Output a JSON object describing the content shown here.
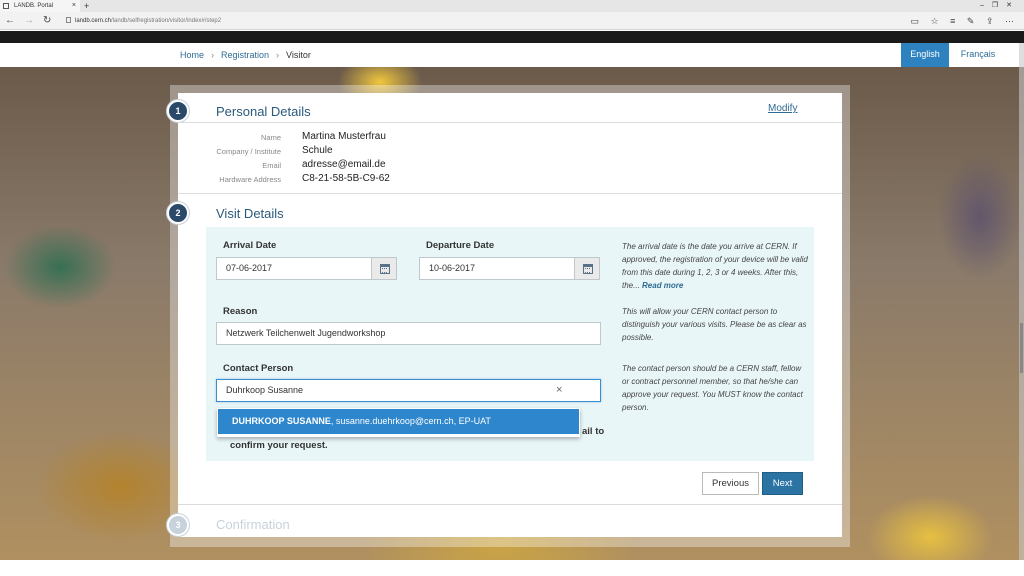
{
  "browser": {
    "tab_title": "LANDB. Portal",
    "url_host": "landb.cern.ch",
    "url_path": "/landb/selfregistration/visitor/index#/step2"
  },
  "breadcrumb": {
    "home": "Home",
    "registration": "Registration",
    "current": "Visitor"
  },
  "languages": {
    "english": "English",
    "french": "Français"
  },
  "steps": {
    "s1": {
      "number": "1",
      "title": "Personal Details",
      "modify": "Modify"
    },
    "s2": {
      "number": "2",
      "title": "Visit Details"
    },
    "s3": {
      "number": "3",
      "title": "Confirmation"
    }
  },
  "personal": {
    "name_label": "Name",
    "name": "Martina Musterfrau",
    "company_label": "Company / Institute",
    "company": "Schule",
    "email_label": "Email",
    "email": "adresse@email.de",
    "hw_label": "Hardware Address",
    "hw": "C8-21-58-5B-C9-62"
  },
  "visit": {
    "arrival_label": "Arrival Date",
    "arrival": "07-06-2017",
    "departure_label": "Departure Date",
    "departure": "10-06-2017",
    "reason_label": "Reason",
    "reason": "Netzwerk Teilchenwelt Jugendworkshop",
    "contact_label": "Contact Person",
    "contact": "Duhrkoop Susanne",
    "help_dates": "The arrival date is the date you arrive at CERN. If approved, the registration of your device will be valid from this date during 1, 2, 3 or 4 weeks. After this, the... ",
    "read_more": "Read more",
    "help_reason": "This will allow your CERN contact person to distinguish your various visits. Please be as clear as possible.",
    "help_contact": "The contact person should be a CERN staff, fellow or contract personnel member, so that he/she can approve your request. You MUST know the contact person.",
    "suggestion_name": "DUHRKOOP SUSANNE",
    "suggestion_rest": ", susanne.duehrkoop@cern.ch, EP-UAT",
    "hidden_line1": "ail to",
    "hidden_line2": "confirm your request."
  },
  "buttons": {
    "previous": "Previous",
    "next": "Next"
  },
  "colors": {
    "primary": "#2a73a3",
    "step_badge": "#2b4968",
    "panel_bg": "#e9f6f8",
    "suggestion_bg": "#2e86cc"
  }
}
